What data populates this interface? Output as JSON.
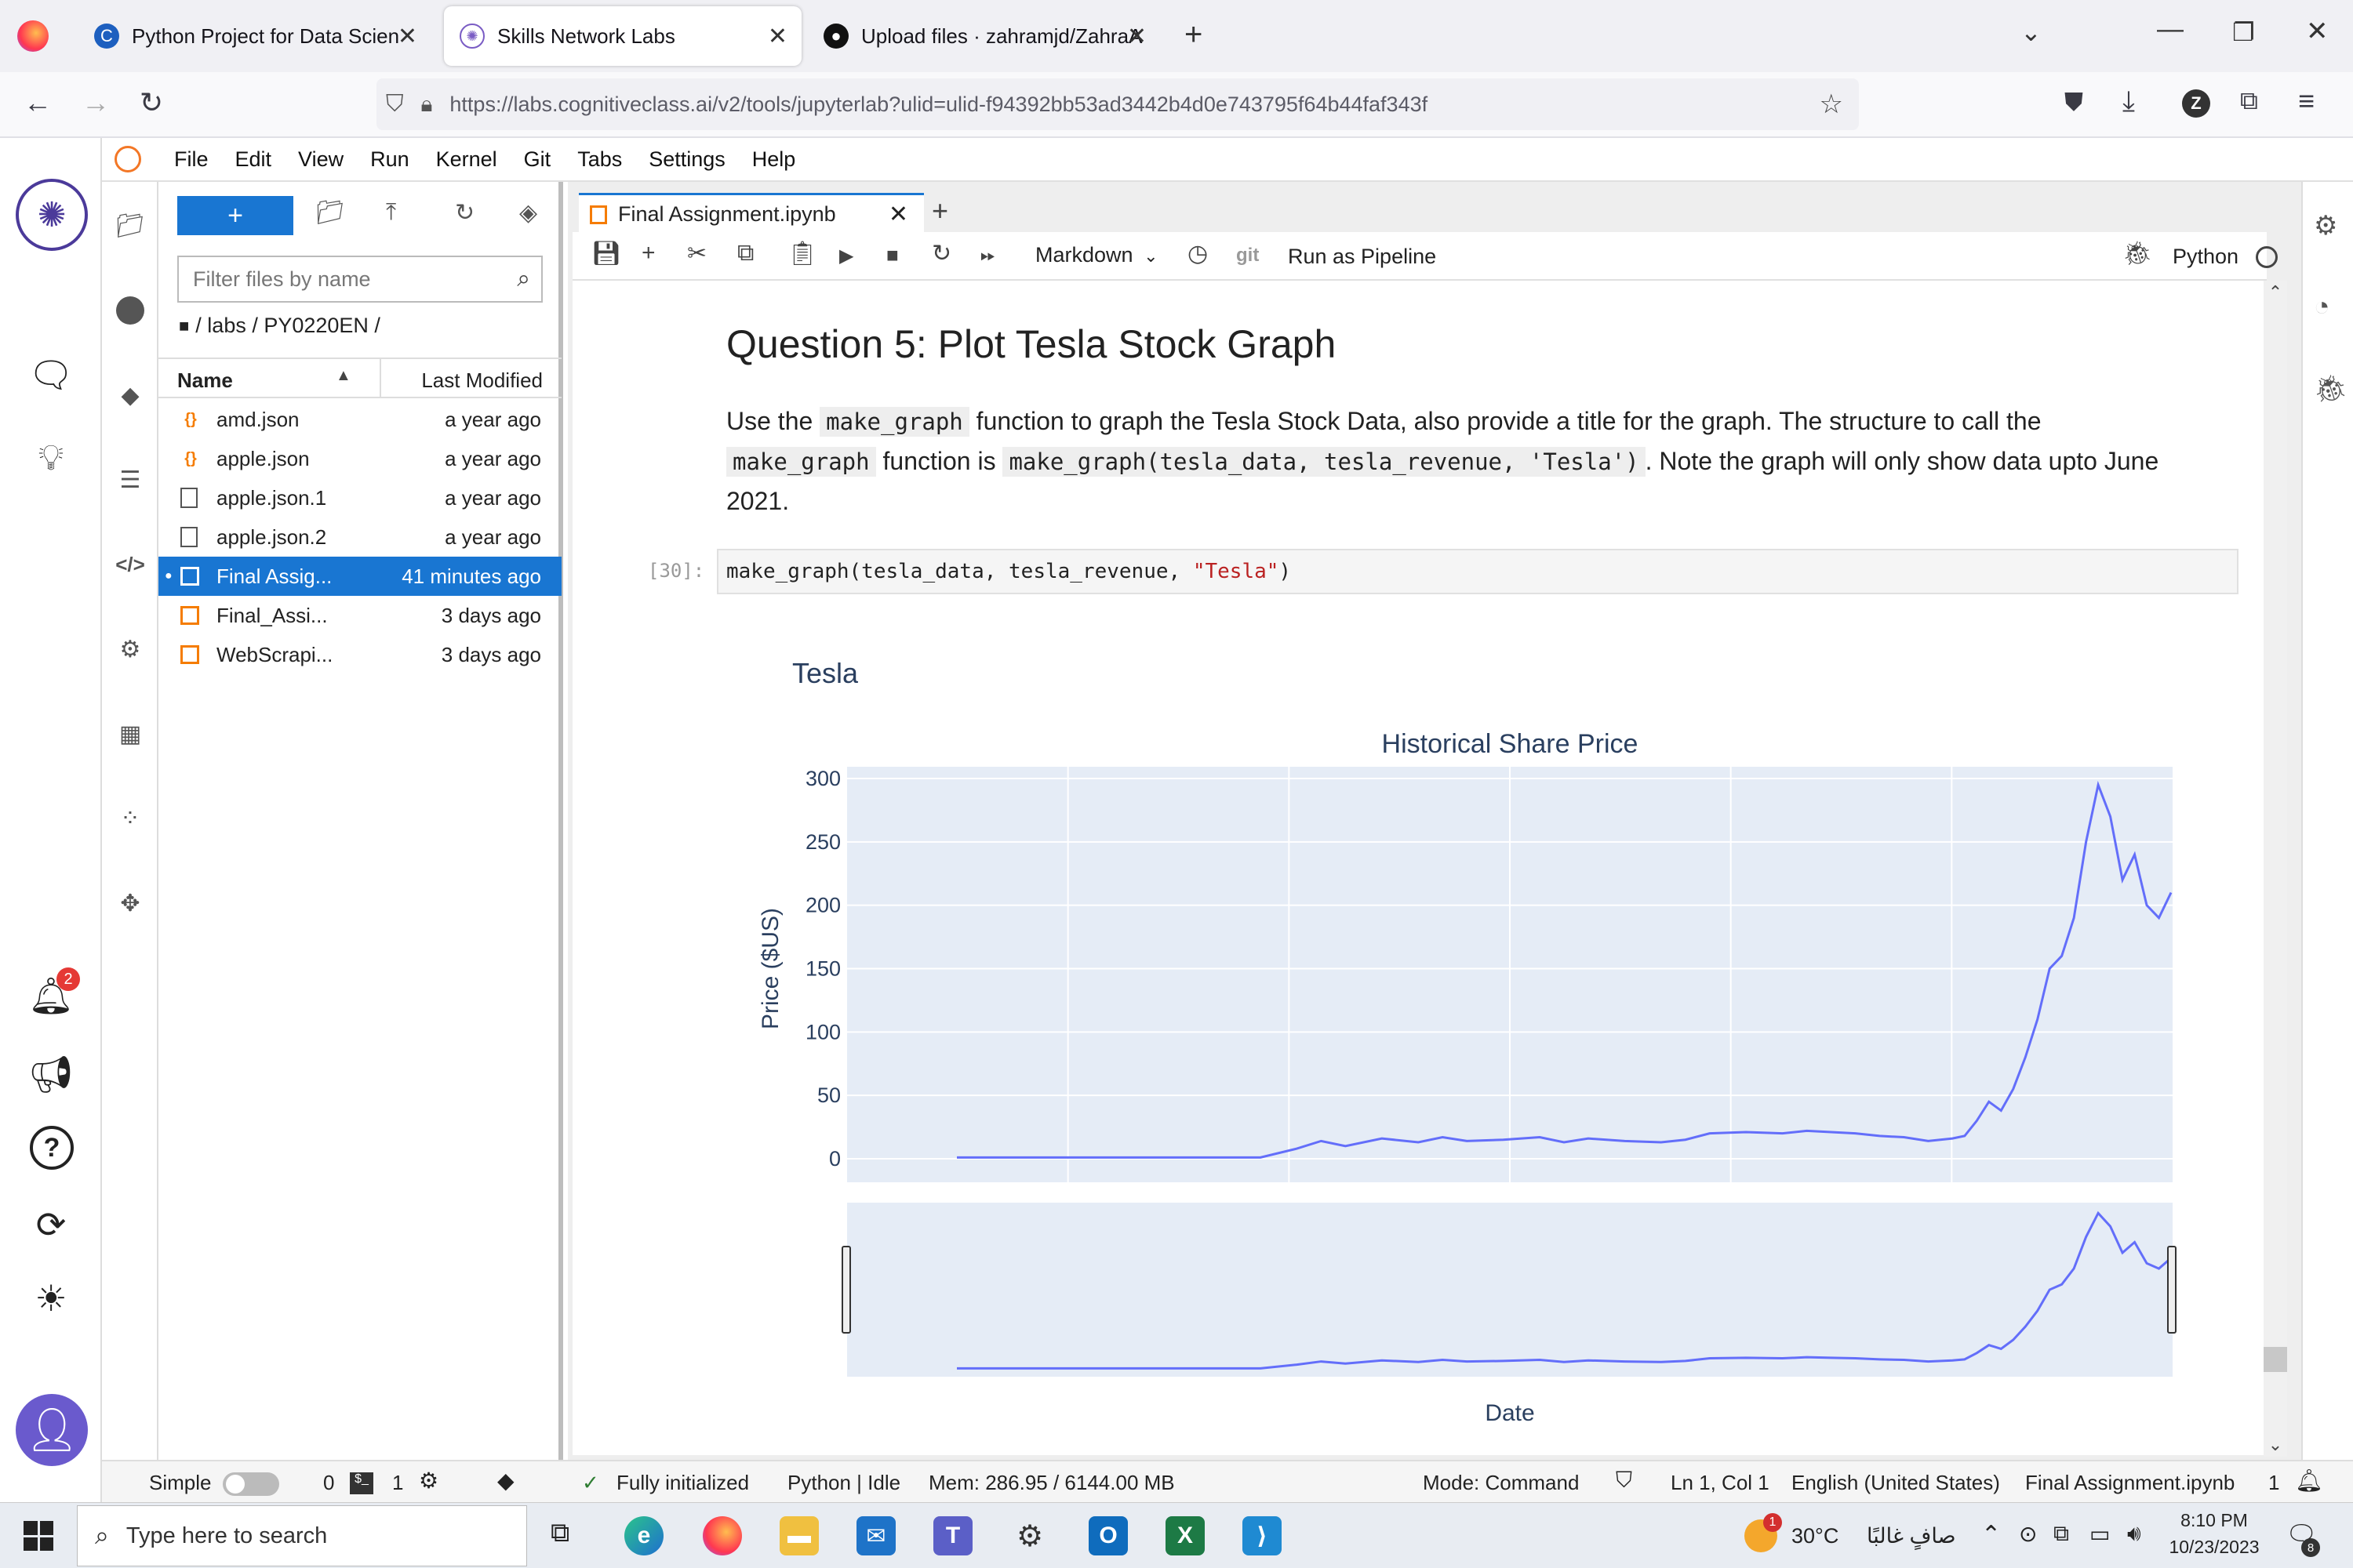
{
  "browser": {
    "tabs": [
      {
        "title": "Python Project for Data Science"
      },
      {
        "title": "Skills Network Labs"
      },
      {
        "title": "Upload files · zahramjd/ZahraAl"
      }
    ],
    "url": "https://labs.cognitiveclass.ai/v2/tools/jupyterlab?ulid=ulid-f94392bb53ad3442b4d0e743795f64b44faf343f",
    "profile_initial": "Z"
  },
  "menu": [
    "File",
    "Edit",
    "View",
    "Run",
    "Kernel",
    "Git",
    "Tabs",
    "Settings",
    "Help"
  ],
  "file_browser": {
    "new_label": "+",
    "filter_placeholder": "Filter files by name",
    "breadcrumb": "/ labs / PY0220EN /",
    "col_name": "Name",
    "col_modified": "Last Modified",
    "files": [
      {
        "name": "amd.json",
        "modified": "a year ago",
        "icon": "json"
      },
      {
        "name": "apple.json",
        "modified": "a year ago",
        "icon": "json"
      },
      {
        "name": "apple.json.1",
        "modified": "a year ago",
        "icon": "file"
      },
      {
        "name": "apple.json.2",
        "modified": "a year ago",
        "icon": "file"
      },
      {
        "name": "Final Assig...",
        "modified": "41 minutes ago",
        "icon": "notebook",
        "selected": true
      },
      {
        "name": "Final_Assi...",
        "modified": "3 days ago",
        "icon": "notebook"
      },
      {
        "name": "WebScrapi...",
        "modified": "3 days ago",
        "icon": "notebook"
      }
    ]
  },
  "notebook": {
    "tab_title": "Final Assignment.ipynb",
    "cell_type": "Markdown",
    "run_pipeline": "Run as Pipeline",
    "git_label": "git",
    "kernel": "Python",
    "heading": "Question 5: Plot Tesla Stock Graph",
    "para_1": "Use the",
    "code_1": "make_graph",
    "para_2": "function to graph the Tesla Stock Data, also provide a title for the graph. The structure to call the",
    "code_2": "make_graph",
    "para_3": "function is",
    "code_3": "make_graph(tesla_data, tesla_revenue, 'Tesla')",
    "para_4": ". Note the graph will only show data upto June 2021.",
    "prompt": "[30]:",
    "code_fn": "make_graph(tesla_data, tesla_revenue, ",
    "code_str": "\"Tesla\"",
    "code_end": ")"
  },
  "chart_data": {
    "type": "line",
    "title": "Tesla",
    "subplot_title": "Historical Share Price",
    "xlabel": "Date",
    "ylabel": "Price ($US)",
    "ylim": [
      0,
      300
    ],
    "yticks": [
      0,
      50,
      100,
      150,
      200,
      250,
      300
    ],
    "color": "#636efa",
    "series": [
      {
        "x": [
          0,
          5,
          10,
          15,
          20,
          25,
          28,
          30,
          32,
          35,
          38,
          40,
          42,
          45,
          48,
          50,
          52,
          55,
          58,
          60,
          62,
          65,
          68,
          70,
          72,
          74,
          76,
          78,
          80,
          82,
          83,
          84,
          85,
          86,
          87,
          88,
          89,
          90,
          91,
          92,
          93,
          94,
          95,
          96,
          97,
          98,
          99,
          100
        ],
        "values": [
          1,
          1,
          1,
          1,
          1,
          1,
          8,
          14,
          10,
          16,
          13,
          17,
          14,
          15,
          17,
          13,
          16,
          14,
          13,
          15,
          20,
          21,
          20,
          22,
          21,
          20,
          18,
          17,
          14,
          16,
          18,
          30,
          45,
          38,
          55,
          80,
          110,
          150,
          160,
          190,
          250,
          295,
          270,
          220,
          240,
          200,
          190,
          210
        ]
      }
    ]
  },
  "status": {
    "simple": "Simple",
    "terminals": "0",
    "kernels": "1",
    "init": "Fully initialized",
    "kernel_state": "Python | Idle",
    "mem": "Mem: 286.95 / 6144.00 MB",
    "mode": "Mode: Command",
    "cursor": "Ln 1, Col 1",
    "lang": "English (United States)",
    "file": "Final Assignment.ipynb",
    "count": "1"
  },
  "taskbar": {
    "search_placeholder": "Type here to search",
    "weather": "30°C",
    "weather_desc": "صافٍ غالبًا",
    "time": "8:10 PM",
    "date": "10/23/2023",
    "weather_badge": "1",
    "notif_badge": "8"
  },
  "left_badge": "2"
}
